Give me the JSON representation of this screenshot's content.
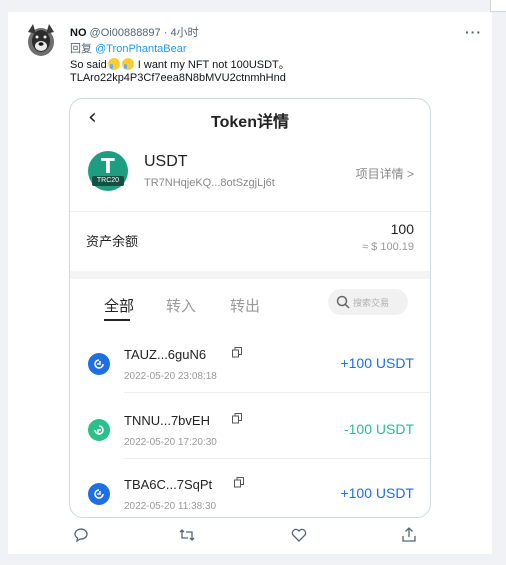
{
  "tweet": {
    "name": "NO",
    "handle_time": " @Oi00888897 · 4小时",
    "reply_prefix": "回复 ",
    "reply_mention": "@TronPhantaBear",
    "text_a": "So said",
    "text_b": " I want my NFT not 100USDT。",
    "text_line2": "TLAro22kp4P3Cf7eea8N8bMVU2ctnmhHnd",
    "more": "···"
  },
  "phone": {
    "back": "‹",
    "title": "Token详情",
    "token": {
      "logo_text": "T",
      "logo_badge": "TRC20",
      "name": "USDT",
      "address": "TR7NHqjeKQ...8otSzgjLj6t",
      "detail_link": "项目详情 >"
    },
    "balance": {
      "label": "资产余额",
      "value": "100",
      "usd": "≈ $ 100.19"
    },
    "tabs": [
      "全部",
      "转入",
      "转出"
    ],
    "search_placeholder": "搜索交易",
    "transactions": [
      {
        "hash": "TAUZ...6guN6",
        "date": "2022-05-20 23:08:18",
        "amount": "+100 USDT",
        "color": "#1e6fe6"
      },
      {
        "hash": "TNNU...7bvEH",
        "date": "2022-05-20 17:20:30",
        "amount": "-100 USDT",
        "color": "#2bbf8a"
      },
      {
        "hash": "TBA6C...7SqPt",
        "date": "2022-05-20 11:38:30",
        "amount": "+100 USDT",
        "color": "#1e6fe6"
      }
    ]
  },
  "colors": {
    "accent_blue": "#1e6fe6",
    "accent_green": "#2bbf8a",
    "link_blue": "#1d9bf0",
    "tron_green": "#1e9e81"
  }
}
